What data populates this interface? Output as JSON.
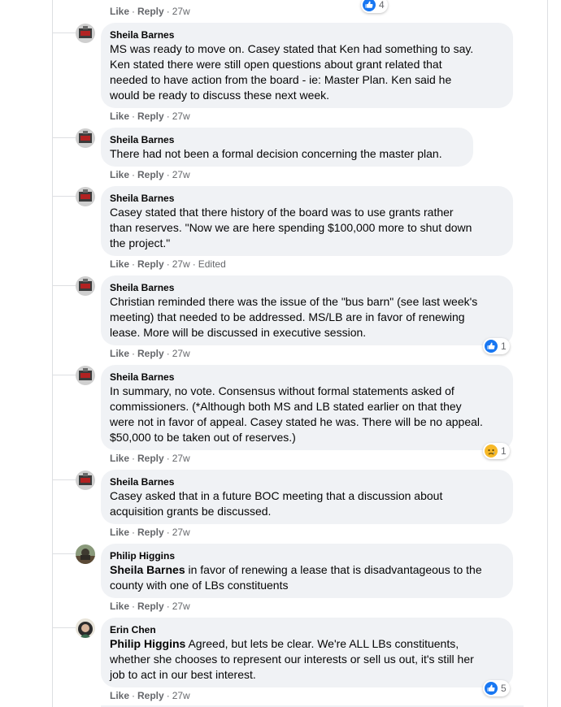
{
  "top_actions": {
    "like": "Like",
    "reply": "Reply",
    "time": "27w",
    "reaction_count": "4"
  },
  "comments": [
    {
      "author": "Sheila Barnes",
      "lines": [
        "MS was ready to move on. Casey stated that Ken had something to say.",
        "Ken stated there were still open questions about grant related that",
        "needed to have action from the board - ie: Master Plan. Ken said he",
        "would be ready to discuss these next week."
      ],
      "like": "Like",
      "reply": "Reply",
      "time": "27w"
    },
    {
      "author": "Sheila Barnes",
      "lines": [
        "There had not been a formal decision concerning the master plan."
      ],
      "like": "Like",
      "reply": "Reply",
      "time": "27w"
    },
    {
      "author": "Sheila Barnes",
      "lines": [
        "Casey stated that there history of the board was to use grants rather",
        "than reserves. \"Now we are here spending $100,000 more to shut down",
        "the project.\""
      ],
      "like": "Like",
      "reply": "Reply",
      "time": "27w",
      "edited": "Edited"
    },
    {
      "author": "Sheila Barnes",
      "lines": [
        "Christian reminded there was the issue of the \"bus barn\" (see last week's",
        "meeting) that needed to be addressed. MS/LB are in favor of renewing",
        "lease. More will be discussed in executive session."
      ],
      "like": "Like",
      "reply": "Reply",
      "time": "27w",
      "reaction": "like",
      "reaction_count": "1"
    },
    {
      "author": "Sheila Barnes",
      "lines": [
        "In summary, no vote. Consensus without formal statements asked of",
        "commissioners. (*Although both MS and LB stated earlier on that they",
        "were not in favor of appeal. Casey stated he was. There will be no appeal.",
        "$50,000 to be taken out of reserves.)"
      ],
      "like": "Like",
      "reply": "Reply",
      "time": "27w",
      "reaction": "sad",
      "reaction_count": "1"
    },
    {
      "author": "Sheila Barnes",
      "lines": [
        "Casey asked that in a future BOC meeting that a discussion about",
        "acquisition grants be discussed."
      ],
      "like": "Like",
      "reply": "Reply",
      "time": "27w"
    },
    {
      "author": "Philip Higgins",
      "tag": "Sheila Barnes",
      "lines": [
        " in favor of renewing a lease that is disadvantageous to the",
        "county with one of LBs constituents"
      ],
      "like": "Like",
      "reply": "Reply",
      "time": "27w"
    },
    {
      "author": "Erin Chen",
      "tag": "Philip Higgins",
      "lines": [
        " Agreed, but lets be clear. We're ALL LBs constituents,",
        "whether she chooses to represent our interests or sell us out, it's still her",
        "job to act in our best interest."
      ],
      "like": "Like",
      "reply": "Reply",
      "time": "27w",
      "reaction": "like",
      "reaction_count": "5"
    }
  ],
  "colors": {
    "bubble": "#f0f2f5",
    "like_blue": "#1877f2",
    "sad_yellow": "#f7b928",
    "meta_gray": "#65676b"
  }
}
